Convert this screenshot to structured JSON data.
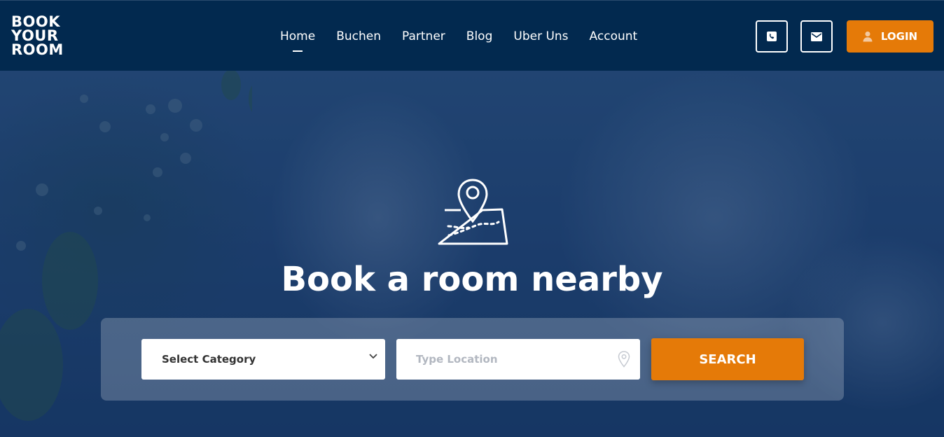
{
  "brand": {
    "logo_lines": [
      "BOOK",
      "YOUR",
      "ROOM"
    ]
  },
  "nav": {
    "items": [
      {
        "label": "Home",
        "active": true
      },
      {
        "label": "Buchen",
        "active": false
      },
      {
        "label": "Partner",
        "active": false
      },
      {
        "label": "Blog",
        "active": false
      },
      {
        "label": "Uber Uns",
        "active": false
      },
      {
        "label": "Account",
        "active": false
      }
    ]
  },
  "header_actions": {
    "phone_icon": "phone-icon",
    "mail_icon": "envelope-icon",
    "login_label": "LOGIN",
    "login_icon": "user-icon"
  },
  "hero": {
    "icon": "map-pin-icon",
    "title": "Book a room nearby"
  },
  "search": {
    "category_selected": "Select Category",
    "location_placeholder": "Type Location",
    "location_value": "",
    "search_label": "SEARCH"
  },
  "colors": {
    "header_bg": "#02294f",
    "accent": "#e57a08",
    "text_light": "#ffffff"
  }
}
